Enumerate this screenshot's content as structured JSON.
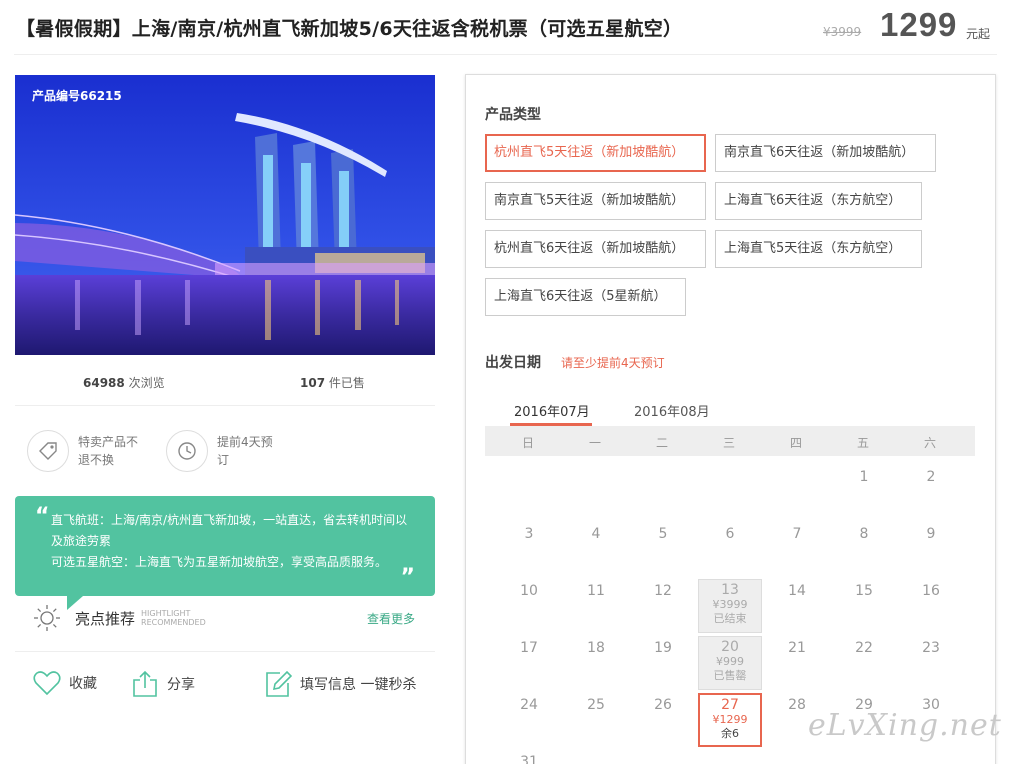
{
  "header": {
    "title": "【暑假假期】上海/南京/杭州直飞新加坡5/6天往返含税机票（可选五星航空）",
    "old_price": "¥3999",
    "price": "1299",
    "price_unit": "元起"
  },
  "left": {
    "product_id": "产品编号66215",
    "views_count": "64988",
    "views_label": "次浏览",
    "sold_count": "107",
    "sold_label": "件已售",
    "features": [
      {
        "icon": "price-tag-icon",
        "text": "特卖产品不退不换"
      },
      {
        "icon": "clock-icon",
        "text": "提前4天预订"
      }
    ],
    "bubble": {
      "line1": "直飞航班：上海/南京/杭州直飞新加坡，一站直达，省去转机时间以及旅途劳累",
      "line2": "可选五星航空：上海直飞为五星新加坡航空，享受高品质服务。"
    },
    "highlight": {
      "title": "亮点推荐",
      "en1": "HIGHTLIGHT",
      "en2": "RECOMMENDED",
      "more": "查看更多"
    },
    "actions": [
      {
        "icon": "heart-icon",
        "label": "收藏"
      },
      {
        "icon": "share-icon",
        "label": "分享"
      },
      {
        "icon": "edit-icon",
        "label": "填写信息 一键秒杀"
      }
    ]
  },
  "right": {
    "product_type_title": "产品类型",
    "options": [
      "杭州直飞5天往返（新加坡酷航）",
      "南京直飞6天往返（新加坡酷航）",
      "南京直飞5天往返（新加坡酷航）",
      "上海直飞6天往返（东方航空）",
      "杭州直飞6天往返（新加坡酷航）",
      "上海直飞5天往返（东方航空）",
      "上海直飞6天往返（5星新航）"
    ],
    "selected_option": 0,
    "departure_title": "出发日期",
    "departure_hint": "请至少提前4天预订",
    "months": [
      "2016年07月",
      "2016年08月"
    ],
    "active_month": 0,
    "weekdays": [
      "日",
      "一",
      "二",
      "三",
      "四",
      "五",
      "六"
    ],
    "days": [
      "1",
      "2",
      "3",
      "4",
      "5",
      "6",
      "7",
      "8",
      "9",
      "10",
      "11",
      "12",
      "14",
      "15",
      "16",
      "17",
      "18",
      "19",
      "21",
      "22",
      "23",
      "24",
      "25",
      "26",
      "28",
      "29",
      "30",
      "31"
    ],
    "special_days": [
      {
        "day": "13",
        "price": "¥3999",
        "status": "已结束"
      },
      {
        "day": "20",
        "price": "¥999",
        "status": "已售罄"
      },
      {
        "day": "27",
        "price": "¥1299",
        "status": "余6"
      }
    ]
  },
  "watermark": "eLvXing.net"
}
